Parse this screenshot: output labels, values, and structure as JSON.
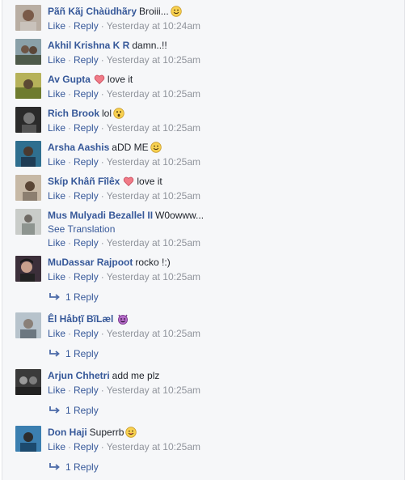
{
  "actions": {
    "like": "Like",
    "reply": "Reply",
    "dot": "·"
  },
  "comments": [
    {
      "author": "Pãñ Kãj Chàüdhãry",
      "text": "Broiii...",
      "emoji": "smile",
      "time": "Yesterday at 10:24am"
    },
    {
      "author": "Akhil Krishna K R",
      "text": "damn..!!",
      "emoji": "",
      "time": "Yesterday at 10:25am"
    },
    {
      "author": "Av Gupta",
      "text": "love it",
      "emoji": "heart-before",
      "time": "Yesterday at 10:25am"
    },
    {
      "author": "Rich Brook",
      "text": "lol",
      "emoji": "wow",
      "time": "Yesterday at 10:25am"
    },
    {
      "author": "Arsha Aashis",
      "text": "aDD ME",
      "emoji": "smile",
      "time": "Yesterday at 10:25am"
    },
    {
      "author": "Skíp Khâñ Fîlêx",
      "text": "love it",
      "emoji": "heart-before",
      "time": "Yesterday at 10:25am"
    },
    {
      "author": "Mus Mulyadi Bezallel II",
      "text": "W0owww...",
      "emoji": "",
      "see_translation": "See Translation",
      "time": "Yesterday at 10:25am"
    },
    {
      "author": "MuDassar Rajpoot",
      "text": "rocko !:)",
      "emoji": "",
      "time": "Yesterday at 10:25am",
      "replies": "1 Reply"
    },
    {
      "author": "Êl Håbțĩ BĩLæl",
      "text": "",
      "emoji": "devil",
      "time": "Yesterday at 10:25am",
      "replies": "1 Reply"
    },
    {
      "author": "Arjun Chhetri",
      "text": "add me plz",
      "emoji": "",
      "time": "Yesterday at 10:25am",
      "replies": "1 Reply"
    },
    {
      "author": "Don Haji",
      "text": "Superrb",
      "emoji": "wink",
      "time": "Yesterday at 10:25am",
      "replies": "1 Reply"
    }
  ]
}
